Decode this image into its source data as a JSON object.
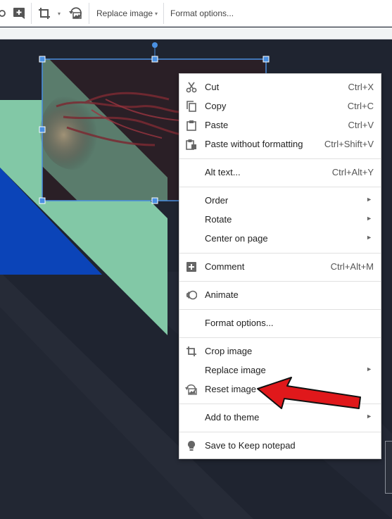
{
  "toolbar": {
    "replace_image_label": "Replace image",
    "format_options_label": "Format options..."
  },
  "icons": {
    "toolbar": [
      "partial-icon",
      "add-comment-icon",
      "crop-icon",
      "dropdown-caret-icon",
      "reset-image-icon"
    ],
    "menu": [
      "scissors-icon",
      "copy-icon",
      "clipboard-icon",
      "paste-plain-icon",
      "comment-plus-icon",
      "animate-icon",
      "crop-icon",
      "reset-image-icon",
      "lightbulb-icon"
    ]
  },
  "menu": {
    "items": [
      {
        "label": "Cut",
        "shortcut": "Ctrl+X"
      },
      {
        "label": "Copy",
        "shortcut": "Ctrl+C"
      },
      {
        "label": "Paste",
        "shortcut": "Ctrl+V"
      },
      {
        "label": "Paste without formatting",
        "shortcut": "Ctrl+Shift+V"
      },
      {
        "label": "Alt text...",
        "shortcut": "Ctrl+Alt+Y"
      },
      {
        "label": "Order",
        "submenu": true
      },
      {
        "label": "Rotate",
        "submenu": true
      },
      {
        "label": "Center on page",
        "submenu": true
      },
      {
        "label": "Comment",
        "shortcut": "Ctrl+Alt+M"
      },
      {
        "label": "Animate"
      },
      {
        "label": "Format options..."
      },
      {
        "label": "Crop image"
      },
      {
        "label": "Replace image",
        "submenu": true
      },
      {
        "label": "Reset image"
      },
      {
        "label": "Add to theme",
        "submenu": true
      },
      {
        "label": "Save to Keep notepad"
      }
    ],
    "submenu_arrow": "►"
  },
  "colors": {
    "slide_bg": "#1f2430",
    "green_shape": "#82c8a6",
    "blue_shape": "#0b44b8",
    "selection": "#4a90e2",
    "annotation_arrow": "#e0181b"
  }
}
